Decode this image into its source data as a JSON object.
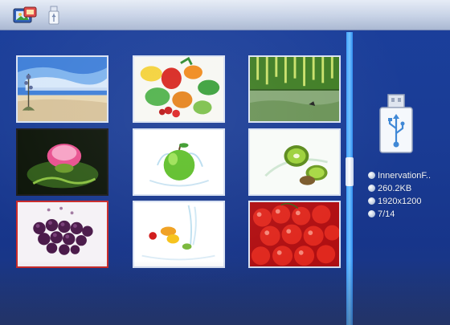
{
  "topbar": {
    "icons": [
      "photo-mode-icon",
      "usb-source-icon"
    ]
  },
  "thumbnails": [
    {
      "name": "thumb-beach-plant",
      "selected": false
    },
    {
      "name": "thumb-vegetables",
      "selected": false
    },
    {
      "name": "thumb-hanging-vines",
      "selected": false
    },
    {
      "name": "thumb-thistle-flower",
      "selected": false
    },
    {
      "name": "thumb-green-apple",
      "selected": false
    },
    {
      "name": "thumb-kiwi",
      "selected": false
    },
    {
      "name": "thumb-grapes",
      "selected": true
    },
    {
      "name": "thumb-fruit-splash",
      "selected": false
    },
    {
      "name": "thumb-cherries",
      "selected": false
    }
  ],
  "info": {
    "filename": "InnervationF..",
    "filesize": "260.2KB",
    "resolution": "1920x1200",
    "position": "7/14"
  },
  "colors": {
    "background": "#1b3f9c",
    "selection": "#c92a2a",
    "scrollbar": "#3fa1ff"
  }
}
